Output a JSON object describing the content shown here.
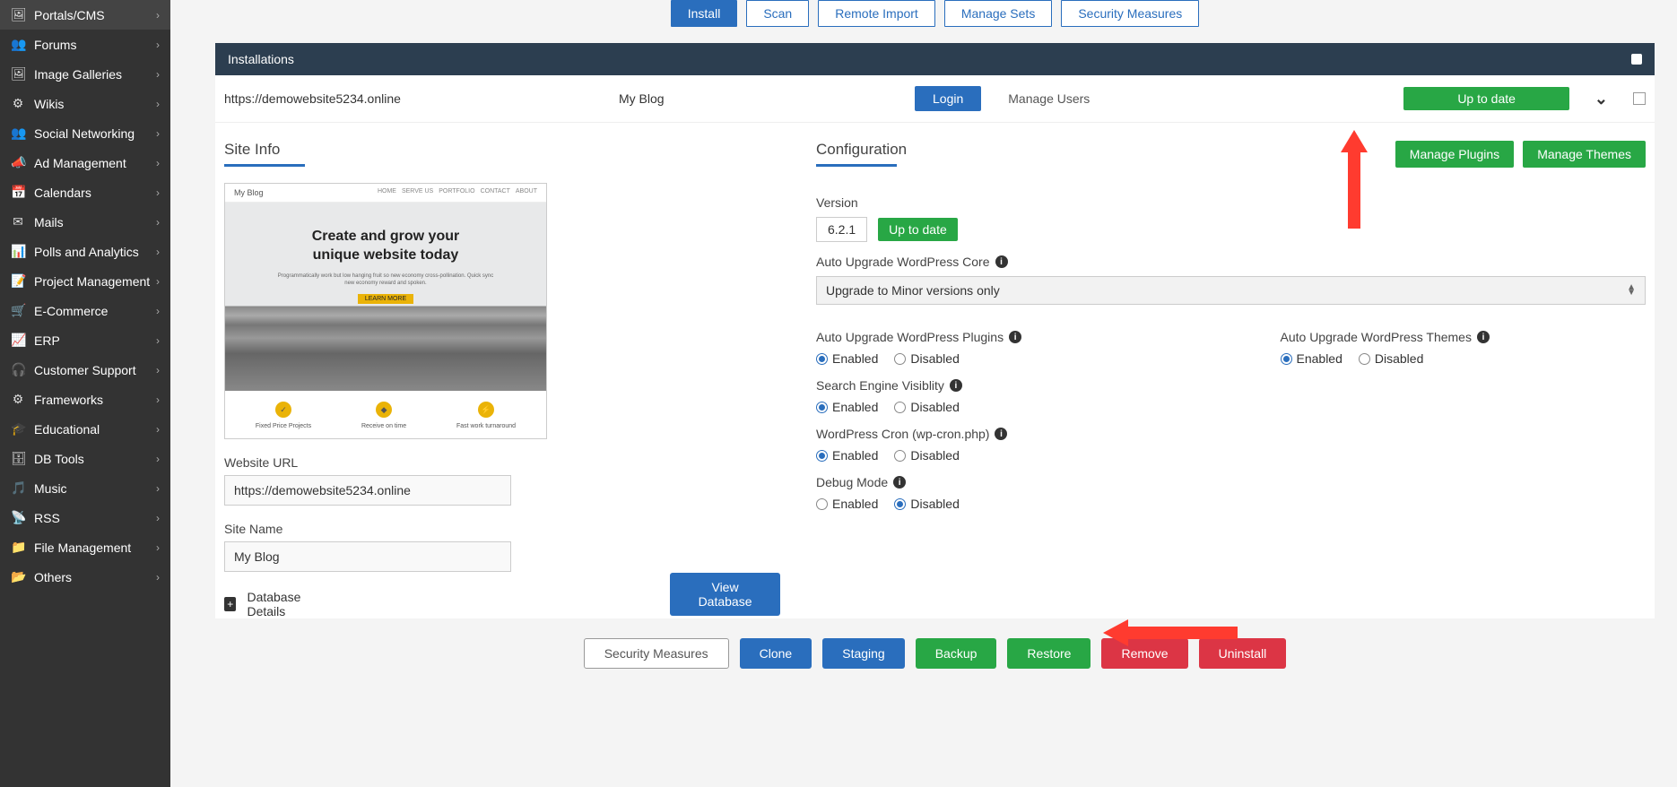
{
  "sidebar": {
    "items": [
      {
        "icon": "🖼",
        "label": "Portals/CMS"
      },
      {
        "icon": "👥",
        "label": "Forums"
      },
      {
        "icon": "🖼",
        "label": "Image Galleries"
      },
      {
        "icon": "⚙",
        "label": "Wikis"
      },
      {
        "icon": "👥",
        "label": "Social Networking"
      },
      {
        "icon": "📣",
        "label": "Ad Management"
      },
      {
        "icon": "📅",
        "label": "Calendars"
      },
      {
        "icon": "✉",
        "label": "Mails"
      },
      {
        "icon": "📊",
        "label": "Polls and Analytics"
      },
      {
        "icon": "📝",
        "label": "Project Management"
      },
      {
        "icon": "🛒",
        "label": "E-Commerce"
      },
      {
        "icon": "📈",
        "label": "ERP"
      },
      {
        "icon": "🎧",
        "label": "Customer Support"
      },
      {
        "icon": "⚙",
        "label": "Frameworks"
      },
      {
        "icon": "🎓",
        "label": "Educational"
      },
      {
        "icon": "🗄",
        "label": "DB Tools"
      },
      {
        "icon": "🎵",
        "label": "Music"
      },
      {
        "icon": "📡",
        "label": "RSS"
      },
      {
        "icon": "📁",
        "label": "File Management"
      },
      {
        "icon": "📂",
        "label": "Others"
      }
    ]
  },
  "tabs": [
    "Install",
    "Scan",
    "Remote Import",
    "Manage Sets",
    "Security Measures"
  ],
  "panel_title": "Installations",
  "install": {
    "url": "https://demowebsite5234.online",
    "name": "My Blog",
    "login_btn": "Login",
    "manage_users": "Manage Users",
    "status": "Up to date"
  },
  "site_info": {
    "title": "Site Info",
    "preview": {
      "blog_title": "My Blog",
      "menu": [
        "HOME",
        "SERVE US",
        "PORTFOLIO",
        "CONTACT",
        "ABOUT"
      ],
      "hero_h1": "Create and grow your",
      "hero_h2": "unique website today",
      "hero_p": "Programmatically work but low hanging fruit so new economy cross-pollination. Quick sync new economy reward and spoken.",
      "cta": "LEARN MORE",
      "feat1": "Fixed Price Projects",
      "feat2": "Receive on time",
      "feat3": "Fast work turnaround"
    },
    "url_label": "Website URL",
    "url_value": "https://demowebsite5234.online",
    "name_label": "Site Name",
    "name_value": "My Blog",
    "db_label": "Database Details",
    "view_db": "View Database"
  },
  "config": {
    "title": "Configuration",
    "manage_plugins": "Manage Plugins",
    "manage_themes": "Manage Themes",
    "version_label": "Version",
    "version": "6.2.1",
    "version_status": "Up to date",
    "auto_core": "Auto Upgrade WordPress Core",
    "core_opt": "Upgrade to Minor versions only",
    "auto_plugins": "Auto Upgrade WordPress Plugins",
    "auto_themes": "Auto Upgrade WordPress Themes",
    "sev": "Search Engine Visiblity",
    "cron": "WordPress Cron (wp-cron.php)",
    "debug": "Debug Mode",
    "enabled": "Enabled",
    "disabled": "Disabled"
  },
  "actions": {
    "security": "Security Measures",
    "clone": "Clone",
    "staging": "Staging",
    "backup": "Backup",
    "restore": "Restore",
    "remove": "Remove",
    "uninstall": "Uninstall"
  }
}
